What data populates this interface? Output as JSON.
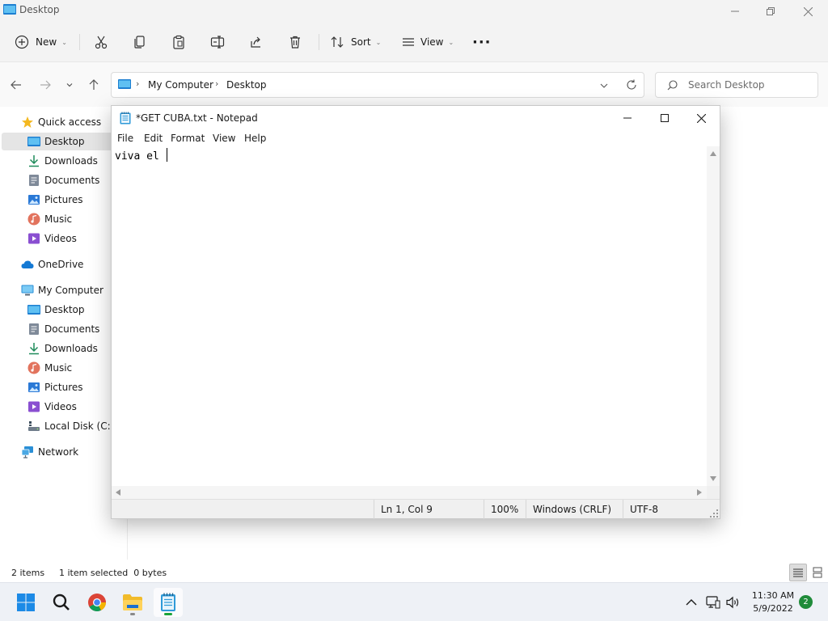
{
  "explorer": {
    "title": "Desktop",
    "commands": {
      "new_label": "New",
      "sort_label": "Sort",
      "view_label": "View",
      "more_label": "···"
    },
    "address": {
      "crumbs": [
        "My Computer",
        "Desktop"
      ]
    },
    "search": {
      "placeholder": "Search Desktop"
    },
    "sidebar": {
      "items": [
        {
          "label": "Quick access",
          "icon": "star-icon"
        },
        {
          "label": "Desktop",
          "icon": "desktop-icon",
          "selected": true
        },
        {
          "label": "Downloads",
          "icon": "download-icon"
        },
        {
          "label": "Documents",
          "icon": "document-icon"
        },
        {
          "label": "Pictures",
          "icon": "picture-icon"
        },
        {
          "label": "Music",
          "icon": "music-icon"
        },
        {
          "label": "Videos",
          "icon": "video-icon"
        },
        {
          "label": "OneDrive",
          "icon": "cloud-icon"
        },
        {
          "label": "My Computer",
          "icon": "computer-icon"
        },
        {
          "label": "Desktop",
          "icon": "desktop-icon"
        },
        {
          "label": "Documents",
          "icon": "document-icon"
        },
        {
          "label": "Downloads",
          "icon": "download-icon"
        },
        {
          "label": "Music",
          "icon": "music-icon"
        },
        {
          "label": "Pictures",
          "icon": "picture-icon"
        },
        {
          "label": "Videos",
          "icon": "video-icon"
        },
        {
          "label": "Local Disk (C:)",
          "icon": "drive-icon"
        },
        {
          "label": "Network",
          "icon": "network-icon"
        }
      ]
    },
    "status": {
      "items_count": "2 items",
      "selection": "1 item selected  0 bytes"
    }
  },
  "notepad": {
    "title": "*GET CUBA.txt - Notepad",
    "menu": [
      "File",
      "Edit",
      "Format",
      "View",
      "Help"
    ],
    "content": "viva el ",
    "status": {
      "position": "Ln 1, Col 9",
      "zoom": "100%",
      "line_ending": "Windows (CRLF)",
      "encoding": "UTF-8"
    }
  },
  "taskbar": {
    "time": "11:30 AM",
    "date": "5/9/2022",
    "notifications": "2"
  },
  "colors": {
    "accent_blue": "#0a84d8",
    "notification_green": "#1f8b3a",
    "selection_gray": "#e5e5e5"
  }
}
